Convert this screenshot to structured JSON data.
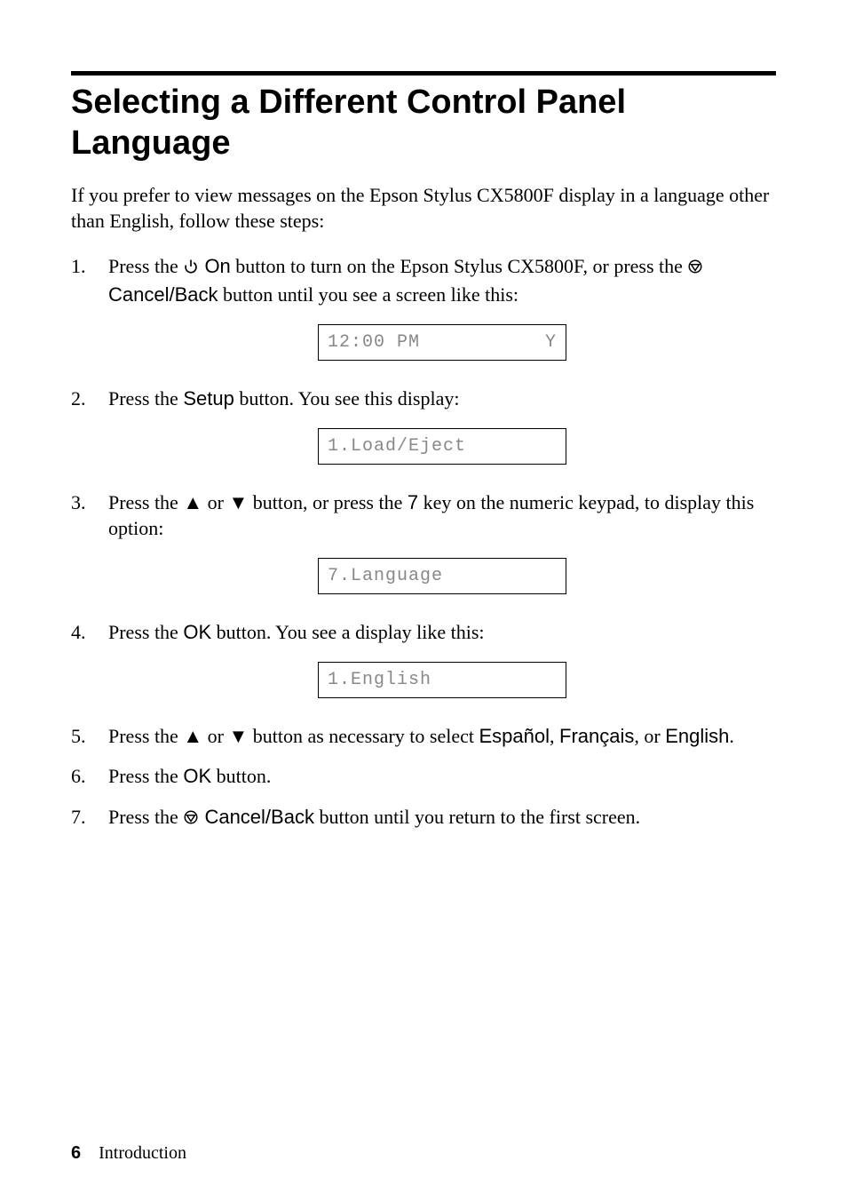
{
  "heading": "Selecting a Different Control Panel Language",
  "intro": "If you prefer to view messages on the Epson Stylus CX5800F display in a language other than English, follow these steps:",
  "steps": {
    "s1a": "Press the ",
    "s1_on": " On",
    "s1b": " button to turn on the Epson Stylus CX5800F, or press the ",
    "s1_cancel": " Cancel/Back",
    "s1c": " button until you see a screen like this:",
    "display1_left": "12:00 PM",
    "display1_right": "Y",
    "s2a": "Press the ",
    "s2_setup": "Setup",
    "s2b": " button. You see this display:",
    "display2": "1.Load/Eject",
    "s3a": "Press the ",
    "up": "▲",
    "s3_or": " or ",
    "down": "▼",
    "s3b": " button, or press the ",
    "seven": "7",
    "s3c": " key on the numeric keypad, to display this option:",
    "display3": "7.Language",
    "s4a": "Press the ",
    "s4_ok": "OK",
    "s4b": " button. You see a display like this:",
    "display4": "1.English",
    "s5a": "Press the ",
    "s5b": " button as necessary to select ",
    "espanol": "Español",
    "comma_sp": ", ",
    "francais": "Français",
    "comma_or": ", or ",
    "english": "English",
    "period": ".",
    "s6a": "Press the ",
    "s6_ok": "OK",
    "s6b": " button.",
    "s7a": "Press the ",
    "s7_cancel": " Cancel/Back",
    "s7b": " button until you return to the first screen."
  },
  "footer": {
    "pagenum": "6",
    "section": "Introduction"
  }
}
